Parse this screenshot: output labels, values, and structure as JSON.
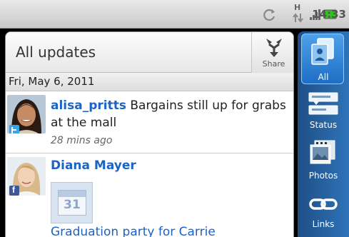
{
  "status_bar": {
    "time": "14:33",
    "network_letter": "H",
    "icons": [
      "sync-icon",
      "h-data-icon",
      "signal-icon",
      "battery-icon"
    ],
    "battery_color": "#2ec41f"
  },
  "header": {
    "title": "All updates",
    "share_label": "Share"
  },
  "feed": {
    "date_header": "Fri, May 6, 2011",
    "items": [
      {
        "author": "alisa_pritts",
        "text": " Bargains still up for grabs at the mall",
        "time": "28 mins ago",
        "network": "twitter"
      },
      {
        "author": "Diana Mayer",
        "calendar_number": "31",
        "event_title": "Graduation party for Carrie",
        "network": "facebook",
        "network_letter": "f"
      }
    ]
  },
  "sidebar": {
    "items": [
      {
        "label": "All",
        "selected": true
      },
      {
        "label": "Status",
        "selected": false
      },
      {
        "label": "Photos",
        "selected": false
      },
      {
        "label": "Links",
        "selected": false
      }
    ]
  },
  "colors": {
    "accent_blue": "#1b63c4",
    "sidebar_blue": "#2f73b8",
    "twitter_blue": "#39a6e5",
    "facebook_blue": "#3b5998"
  }
}
